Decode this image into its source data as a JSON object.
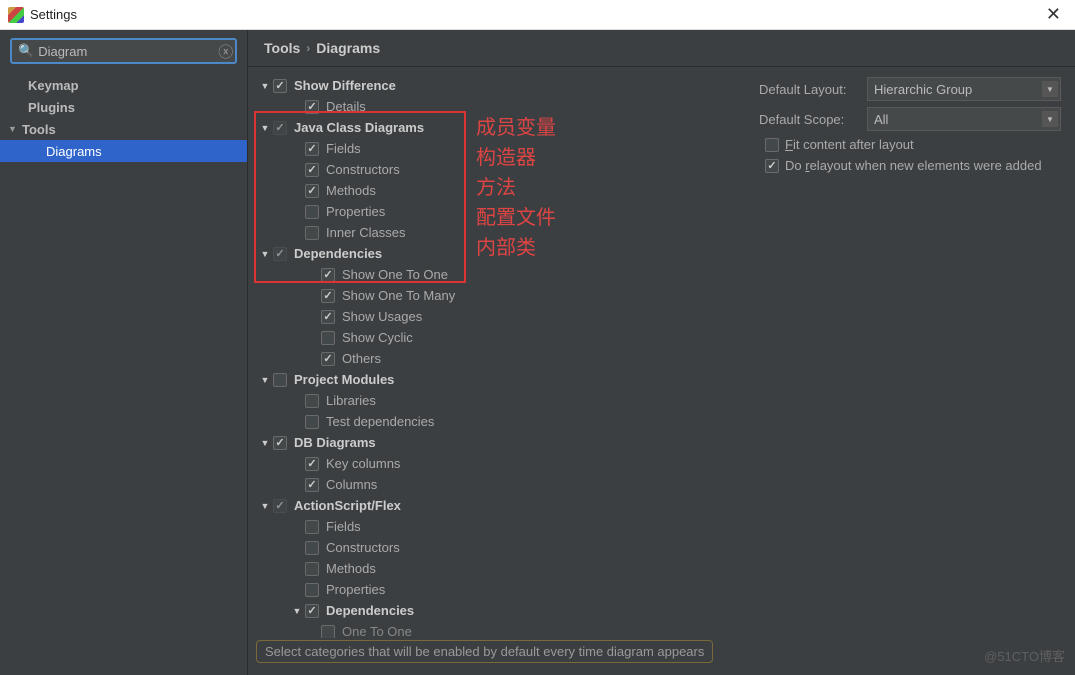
{
  "window": {
    "title": "Settings"
  },
  "search": {
    "value": "Diagram",
    "placeholder": "Search"
  },
  "nav": {
    "items": [
      {
        "label": "Keymap",
        "bold": true,
        "indent": 1,
        "arrow": ""
      },
      {
        "label": "Plugins",
        "bold": true,
        "indent": 1,
        "arrow": ""
      },
      {
        "label": "Tools",
        "bold": true,
        "indent": 0,
        "arrow": "▼"
      },
      {
        "label": "Diagrams",
        "bold": false,
        "indent": 2,
        "arrow": "",
        "selected": true
      }
    ]
  },
  "breadcrumb": {
    "parent": "Tools",
    "current": "Diagrams"
  },
  "categories": [
    {
      "depth": 0,
      "arrow": "▼",
      "checked": true,
      "label": "Show Difference"
    },
    {
      "depth": 1,
      "arrow": "",
      "checked": true,
      "label": "Details"
    },
    {
      "depth": 0,
      "arrow": "▼",
      "checked": true,
      "light": true,
      "label": "Java Class Diagrams"
    },
    {
      "depth": 1,
      "arrow": "",
      "checked": true,
      "label": "Fields"
    },
    {
      "depth": 1,
      "arrow": "",
      "checked": true,
      "label": "Constructors"
    },
    {
      "depth": 1,
      "arrow": "",
      "checked": true,
      "label": "Methods"
    },
    {
      "depth": 1,
      "arrow": "",
      "checked": false,
      "label": "Properties"
    },
    {
      "depth": 1,
      "arrow": "",
      "checked": false,
      "label": "Inner Classes"
    },
    {
      "depth": 0,
      "arrow": "▼",
      "checked": true,
      "light": true,
      "label": "Dependencies"
    },
    {
      "depth": 2,
      "arrow": "",
      "checked": true,
      "label": "Show One To One"
    },
    {
      "depth": 2,
      "arrow": "",
      "checked": true,
      "label": "Show One To Many"
    },
    {
      "depth": 2,
      "arrow": "",
      "checked": true,
      "label": "Show Usages"
    },
    {
      "depth": 2,
      "arrow": "",
      "checked": false,
      "label": "Show Cyclic"
    },
    {
      "depth": 2,
      "arrow": "",
      "checked": true,
      "label": "Others"
    },
    {
      "depth": 0,
      "arrow": "▼",
      "checked": false,
      "label": "Project Modules"
    },
    {
      "depth": 1,
      "arrow": "",
      "checked": false,
      "label": "Libraries"
    },
    {
      "depth": 1,
      "arrow": "",
      "checked": false,
      "label": "Test dependencies"
    },
    {
      "depth": 0,
      "arrow": "▼",
      "checked": true,
      "label": "DB Diagrams"
    },
    {
      "depth": 1,
      "arrow": "",
      "checked": true,
      "label": "Key columns"
    },
    {
      "depth": 1,
      "arrow": "",
      "checked": true,
      "label": "Columns"
    },
    {
      "depth": 0,
      "arrow": "▼",
      "checked": true,
      "light": true,
      "label": "ActionScript/Flex"
    },
    {
      "depth": 1,
      "arrow": "",
      "checked": false,
      "label": "Fields"
    },
    {
      "depth": 1,
      "arrow": "",
      "checked": false,
      "label": "Constructors"
    },
    {
      "depth": 1,
      "arrow": "",
      "checked": false,
      "label": "Methods"
    },
    {
      "depth": 1,
      "arrow": "",
      "checked": false,
      "label": "Properties"
    },
    {
      "depth": 1,
      "arrow": "▼",
      "checked": true,
      "label": "Dependencies",
      "bold": true
    },
    {
      "depth": 2,
      "arrow": "",
      "checked": false,
      "label": "One To One",
      "dim": true
    }
  ],
  "hint": "Select categories that will be enabled by default every time diagram appears",
  "right": {
    "layout_label": "Default Layout:",
    "layout_value": "Hierarchic Group",
    "scope_label": "Default Scope:",
    "scope_value": "All",
    "fit_label_pre": "F",
    "fit_label_post": "it content after layout",
    "fit_checked": false,
    "relayout_pre": "Do ",
    "relayout_u": "r",
    "relayout_post": "elayout when new elements were added",
    "relayout_checked": true
  },
  "annotations": {
    "a1": "成员变量",
    "a2": "构造器",
    "a3": "方法",
    "a4": "配置文件",
    "a5": "内部类"
  },
  "watermark": "@51CTO博客"
}
